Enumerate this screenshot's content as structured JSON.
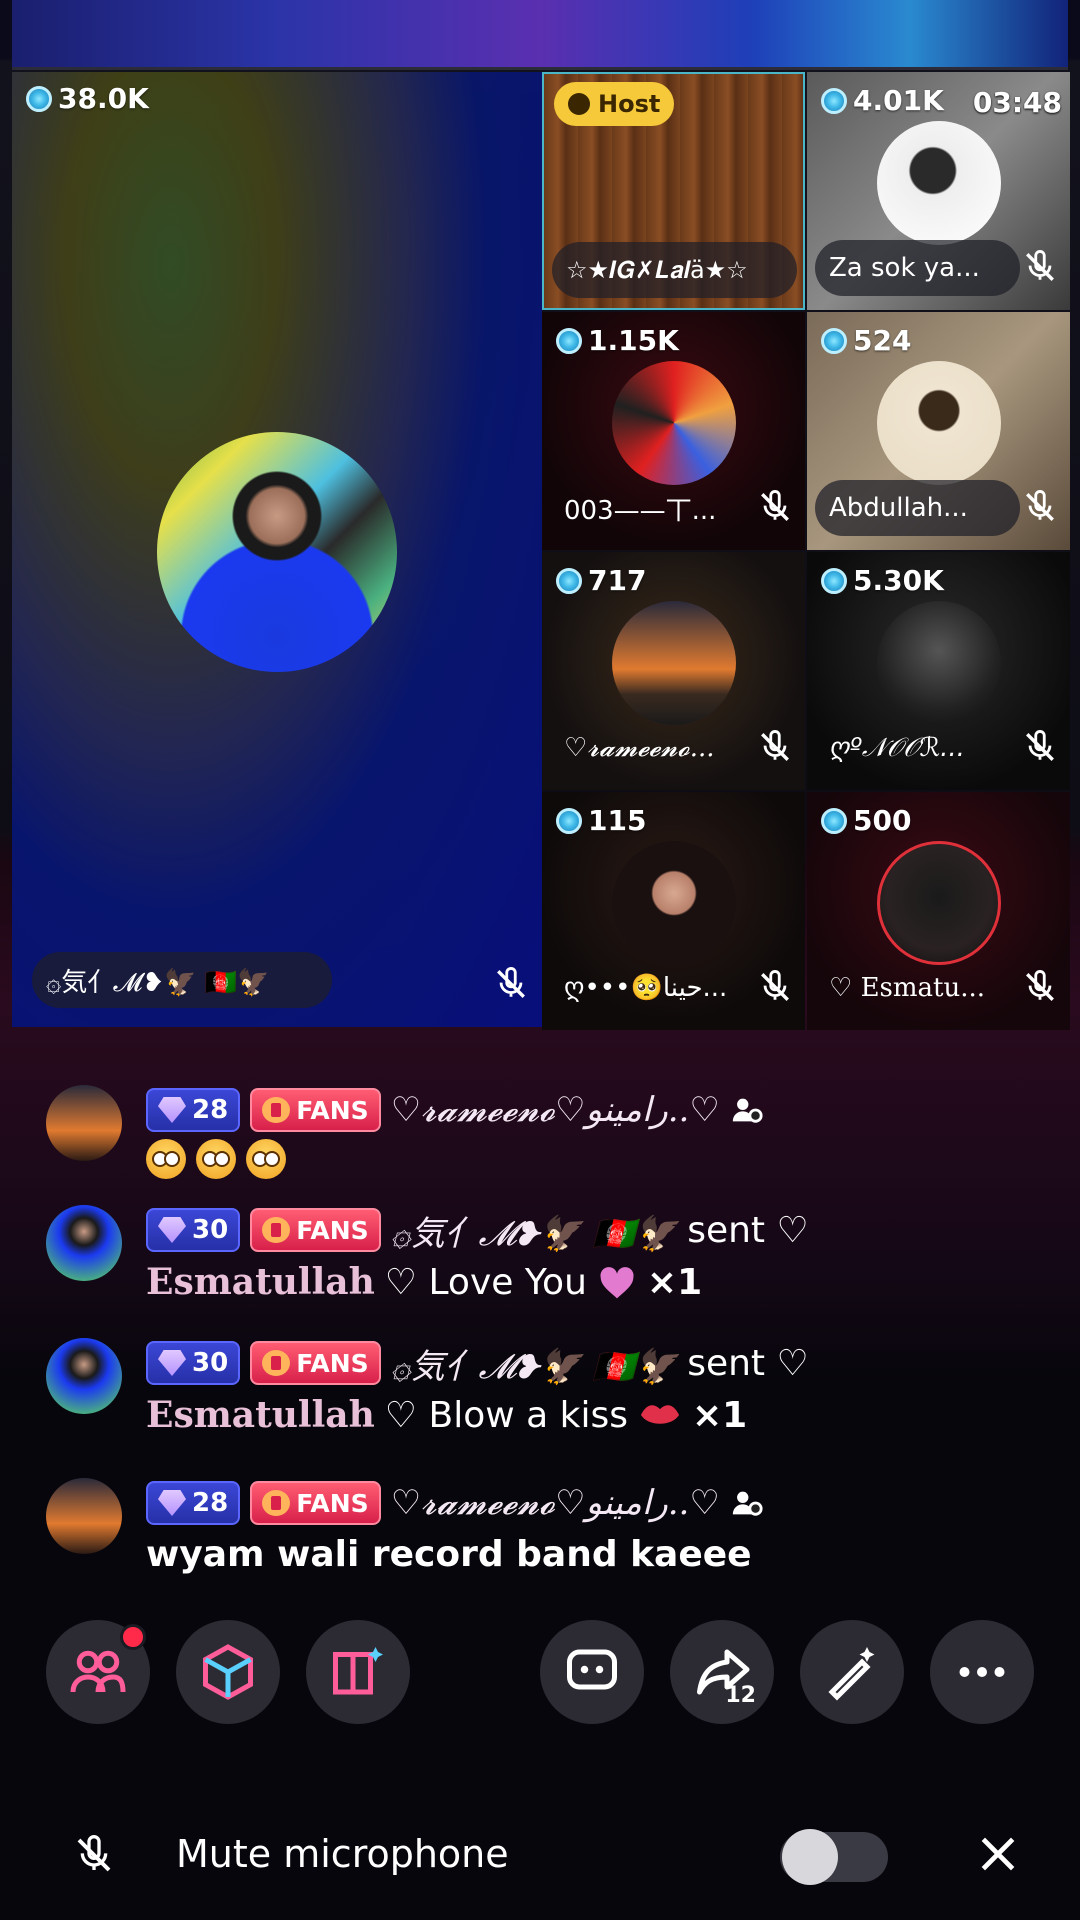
{
  "main_host": {
    "coins": "38.0K",
    "name": "۞気亻𝓜❥🦅 🇦🇫🦅"
  },
  "tiles": [
    {
      "host_label": "Host",
      "name": "☆★𝑰𝑮✗𝑳𝒂𝒍ä★☆"
    },
    {
      "coins": "4.01K",
      "timer": "03:48",
      "name": "Za sok ya..."
    },
    {
      "coins": "1.15K",
      "name": "003——丅..."
    },
    {
      "coins": "524",
      "name": "Abdullah..."
    },
    {
      "coins": "717",
      "name": "♡𝓻𝓪𝓶𝓮𝓮𝓷𝓸..."
    },
    {
      "coins": "5.30K",
      "name": "ღº𝒩𝒪𝒪ℛ..."
    },
    {
      "coins": "115",
      "name": "ღ•••🥺حينا..."
    },
    {
      "coins": "500",
      "name": "♡ Esmatu..."
    }
  ],
  "chat": [
    {
      "level": "28",
      "fans": "FANS",
      "user": "♡𝓻𝓪𝓶𝓮𝓮𝓷𝓸♡رامینو..♡",
      "text": ""
    },
    {
      "level": "30",
      "fans": "FANS",
      "user": "۞気亻𝓜❥🦅 🇦🇫🦅",
      "sent": "sent ♡",
      "recipient": "Esmatullah",
      "gift": "♡ Love You",
      "count": "×1"
    },
    {
      "level": "30",
      "fans": "FANS",
      "user": "۞気亻𝓜❥🦅 🇦🇫🦅",
      "sent": "sent ♡",
      "recipient": "Esmatullah",
      "gift": "♡ Blow a kiss",
      "count": "×1"
    },
    {
      "level": "28",
      "fans": "FANS",
      "user": "♡𝓻𝓪𝓶𝓮𝓮𝓷𝓸♡رامینو..♡",
      "text": "wyam wali record band kaeee"
    }
  ],
  "share_count": "12",
  "footer": {
    "label": "Mute microphone"
  },
  "colors": {
    "accent": "#ff2a4a",
    "host_badge": "#f6c93a",
    "level_badge": "#3b47d6",
    "fans_badge": "#d8204a"
  },
  "icons": [
    "coin-icon",
    "mic-off-icon",
    "user-plus-icon",
    "guests-icon",
    "gift-box-icon",
    "book-sparkle-icon",
    "chat-icon",
    "share-icon",
    "magic-wand-icon",
    "more-icon",
    "close-icon"
  ]
}
